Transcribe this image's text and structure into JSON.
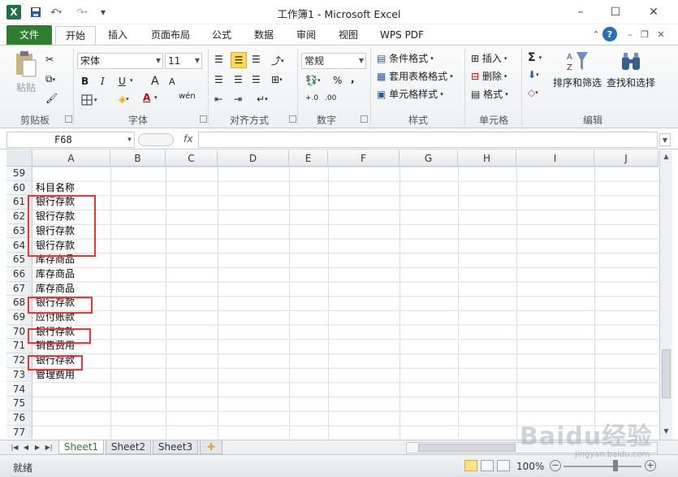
{
  "window": {
    "title": "工作簿1 - Microsoft Excel",
    "minimize_glyph": "–",
    "maximize_glyph": "☐",
    "close_glyph": "✕"
  },
  "quick_access": [
    "excel-logo-icon",
    "save-icon",
    "undo-icon",
    "redo-icon",
    "customize-icon"
  ],
  "tabs": {
    "file": "文件",
    "items": [
      "开始",
      "插入",
      "页面布局",
      "公式",
      "数据",
      "审阅",
      "视图",
      "WPS PDF"
    ],
    "active": "开始"
  },
  "ribbon": {
    "clipboard": {
      "paste": "粘贴",
      "label": "剪贴板"
    },
    "font": {
      "name": "宋体",
      "size": "11",
      "label": "字体",
      "bold": "B",
      "italic": "I",
      "underline": "U",
      "grow": "A",
      "shrink": "A",
      "font_color": "A",
      "wen": "wén"
    },
    "alignment": {
      "label": "对齐方式"
    },
    "number": {
      "format": "常规",
      "label": "数字",
      "percent": "%",
      "comma": ",",
      "dec_inc": "+.0",
      "dec_dec": ".00"
    },
    "styles": {
      "cond": "条件格式",
      "table": "套用表格格式",
      "cell": "单元格样式",
      "label": "样式"
    },
    "cells": {
      "insert": "插入",
      "delete": "删除",
      "format": "格式",
      "label": "单元格"
    },
    "editing": {
      "sum": "Σ",
      "sort": "排序和筛选",
      "find": "查找和选择",
      "label": "编辑"
    }
  },
  "formula_bar": {
    "cell_ref": "F68",
    "fx": "fx",
    "value": ""
  },
  "columns": [
    "A",
    "B",
    "C",
    "D",
    "E",
    "F",
    "G",
    "H",
    "I",
    "J"
  ],
  "rows": [
    {
      "n": "59",
      "a": ""
    },
    {
      "n": "60",
      "a": "科目名称"
    },
    {
      "n": "61",
      "a": "银行存款"
    },
    {
      "n": "62",
      "a": "银行存款"
    },
    {
      "n": "63",
      "a": "银行存款"
    },
    {
      "n": "64",
      "a": "银行存款"
    },
    {
      "n": "65",
      "a": "库存商品"
    },
    {
      "n": "66",
      "a": "库存商品"
    },
    {
      "n": "67",
      "a": "库存商品"
    },
    {
      "n": "68",
      "a": "银行存款"
    },
    {
      "n": "69",
      "a": "应付账款"
    },
    {
      "n": "70",
      "a": "银行存款"
    },
    {
      "n": "71",
      "a": "销售费用"
    },
    {
      "n": "72",
      "a": "银行存款"
    },
    {
      "n": "73",
      "a": "管理费用"
    },
    {
      "n": "74",
      "a": ""
    },
    {
      "n": "75",
      "a": ""
    },
    {
      "n": "76",
      "a": ""
    },
    {
      "n": "77",
      "a": ""
    }
  ],
  "sheets": [
    "Sheet1",
    "Sheet2",
    "Sheet3"
  ],
  "active_sheet": "Sheet1",
  "status": {
    "text": "就绪",
    "zoom": "100%",
    "zoom_minus": "−",
    "zoom_plus": "+"
  },
  "watermark": {
    "logo": "Baidu经验",
    "url": "jingyan.baidu.com"
  },
  "colors": {
    "file_tab": "#2e7d32",
    "highlight": "#e33333",
    "accent": "#2b579a"
  }
}
